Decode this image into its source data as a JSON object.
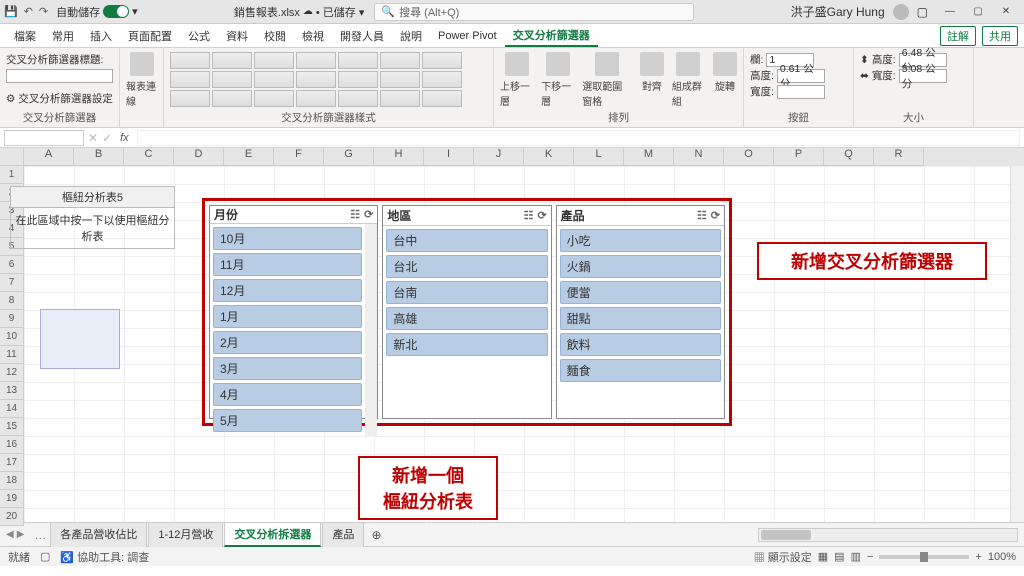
{
  "titlebar": {
    "autosave_label": "自動儲存",
    "autosave_state": "開啟",
    "filename": "銷售報表.xlsx",
    "saved_status": "• 已儲存 ▾",
    "search_placeholder": "搜尋 (Alt+Q)",
    "user": "洪子盛Gary Hung"
  },
  "menu": {
    "tabs": [
      "檔案",
      "常用",
      "插入",
      "頁面配置",
      "公式",
      "資料",
      "校閱",
      "檢視",
      "開發人員",
      "說明",
      "Power Pivot",
      "交叉分析篩選器"
    ],
    "active_index": 11,
    "comments_btn": "註解",
    "share_btn": "共用"
  },
  "ribbon": {
    "group1": {
      "caption_label": "交叉分析篩選器標題:",
      "caption_value": "",
      "settings_label": "交叉分析篩選器設定",
      "group_label": "交叉分析篩選器"
    },
    "group2": {
      "report_conn": "報表連線",
      "group_label": ""
    },
    "styles_label": "交叉分析篩選器樣式",
    "arrange": {
      "bring_forward": "上移一層",
      "send_backward": "下移一層",
      "selection_pane": "選取範圍窗格",
      "align": "對齊",
      "group": "組成群組",
      "rotate": "旋轉",
      "group_label": "排列"
    },
    "buttons": {
      "cols_label": "欄:",
      "cols_val": "1",
      "height_label": "高度:",
      "height_val": "0.61 公分",
      "width_label": "寬度:",
      "width_val": "",
      "group_label": "按鈕"
    },
    "size": {
      "height_label": "高度:",
      "height_val": "6.48 公分",
      "width_label": "寬度:",
      "width_val": "5.08 公分",
      "group_label": "大小"
    }
  },
  "formula": {
    "fx": "fx"
  },
  "columns": [
    "A",
    "B",
    "C",
    "D",
    "E",
    "F",
    "G",
    "H",
    "I",
    "J",
    "K",
    "L",
    "M",
    "N",
    "O",
    "P",
    "Q",
    "R"
  ],
  "rows": [
    "1",
    "2",
    "3",
    "4",
    "5",
    "6",
    "7",
    "8",
    "9",
    "10",
    "11",
    "12",
    "13",
    "14",
    "15",
    "16",
    "17",
    "18",
    "19",
    "20"
  ],
  "pivot": {
    "title": "樞紐分析表5",
    "hint": "在此區域中按一下以使用樞紐分析表"
  },
  "slicers": [
    {
      "title": "月份",
      "items": [
        "10月",
        "11月",
        "12月",
        "1月",
        "2月",
        "3月",
        "4月",
        "5月"
      ],
      "scroll": true
    },
    {
      "title": "地區",
      "items": [
        "台中",
        "台北",
        "台南",
        "高雄",
        "新北"
      ],
      "scroll": false
    },
    {
      "title": "產品",
      "items": [
        "小吃",
        "火鍋",
        "便當",
        "甜點",
        "飲料",
        "麵食"
      ],
      "scroll": false
    }
  ],
  "callouts": {
    "right": "新增交叉分析篩選器",
    "bottom_l1": "新增一個",
    "bottom_l2": "樞紐分析表"
  },
  "sheets": {
    "tabs": [
      "各產品營收佔比",
      "1-12月營收",
      "交叉分析拆選器",
      "產品"
    ],
    "active_index": 2
  },
  "status": {
    "ready": "就緒",
    "accessibility": "協助工具: 調查",
    "display_settings": "顯示設定",
    "zoom": "100%"
  }
}
